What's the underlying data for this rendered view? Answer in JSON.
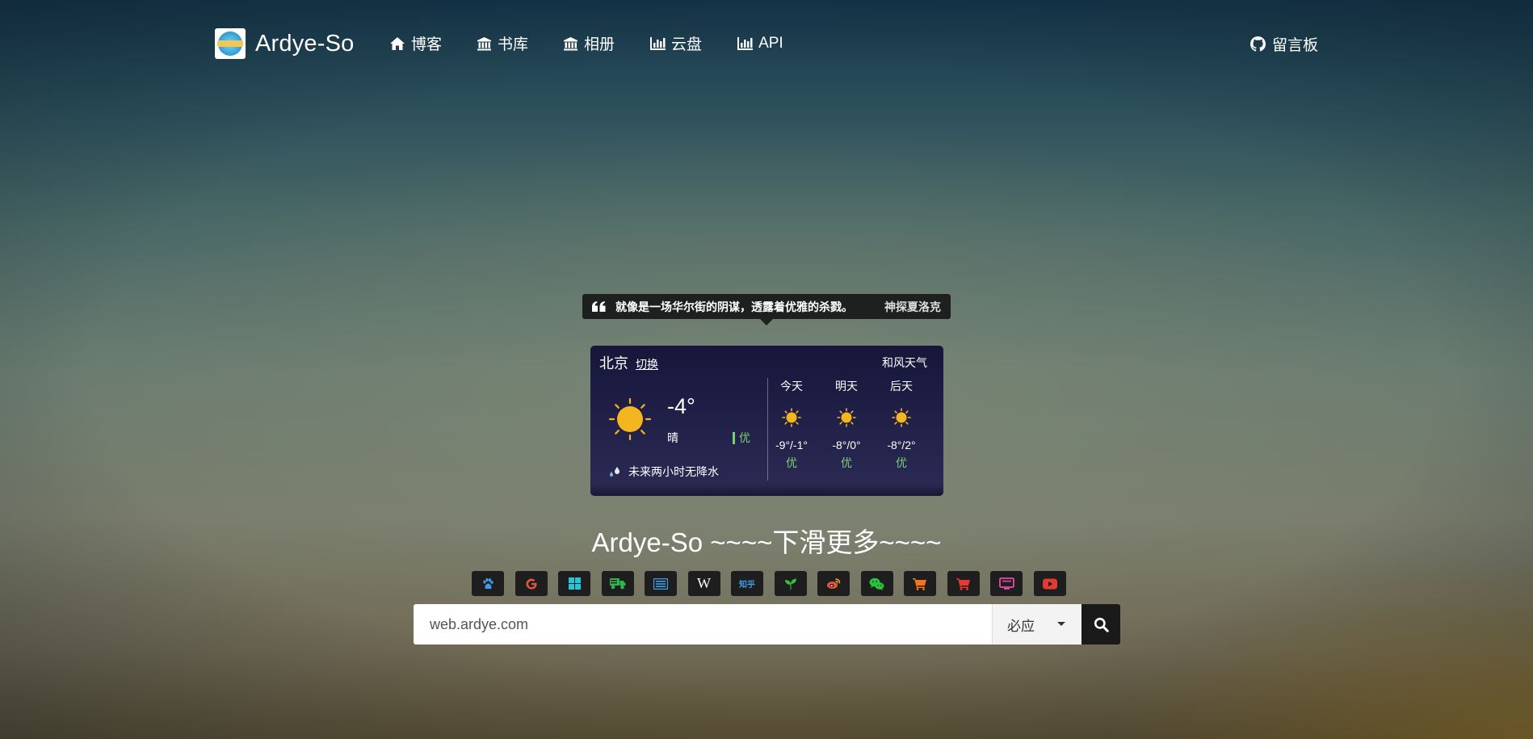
{
  "nav": {
    "brand": "Ardye-So",
    "items": [
      {
        "label": "博客",
        "icon": "home-icon"
      },
      {
        "label": "书库",
        "icon": "bank-icon"
      },
      {
        "label": "相册",
        "icon": "bank-icon"
      },
      {
        "label": "云盘",
        "icon": "bar-chart-icon"
      },
      {
        "label": "API",
        "icon": "bar-chart-icon"
      }
    ],
    "guestbook": {
      "label": "留言板",
      "icon": "github-icon"
    }
  },
  "quote": {
    "text": "就像是一场华尔街的阴谋，透露着优雅的杀戮。",
    "author": "神探夏洛克"
  },
  "weather": {
    "city": "北京",
    "switch": "切换",
    "provider": "和风天气",
    "now": {
      "temp": "-4°",
      "condition": "晴",
      "aqi": "优",
      "icon": "sun-icon"
    },
    "rain_note": "未来两小时无降水",
    "forecast": [
      {
        "day": "今天",
        "range": "-9°/-1°",
        "aqi": "优",
        "icon": "sun-icon"
      },
      {
        "day": "明天",
        "range": "-8°/0°",
        "aqi": "优",
        "icon": "sun-icon"
      },
      {
        "day": "后天",
        "range": "-8°/2°",
        "aqi": "优",
        "icon": "sun-icon"
      }
    ]
  },
  "title": "Ardye-So ~~~~下滑更多~~~~",
  "engines": [
    {
      "name": "baidu",
      "icon": "paw-icon",
      "color": "#3f9ce8"
    },
    {
      "name": "google",
      "icon": "google-icon",
      "color": "#e2553f"
    },
    {
      "name": "bing",
      "icon": "windows-icon",
      "color": "#25c5d8"
    },
    {
      "name": "sogou",
      "icon": "truck-icon",
      "color": "#2bb94d"
    },
    {
      "name": "news",
      "icon": "newspaper-icon",
      "color": "#3f9ce8"
    },
    {
      "name": "wikipedia",
      "icon": "wikipedia-icon",
      "color": "#ffffff",
      "glyph": "W"
    },
    {
      "name": "zhihu",
      "icon": "zhihu-icon",
      "color": "#3f9ce8",
      "glyph": "知乎"
    },
    {
      "name": "douban",
      "icon": "sprout-icon",
      "color": "#37c23c"
    },
    {
      "name": "weibo",
      "icon": "weibo-icon",
      "color": "#e2553f"
    },
    {
      "name": "wechat",
      "icon": "wechat-icon",
      "color": "#2bc23c"
    },
    {
      "name": "taobao",
      "icon": "cart-icon",
      "color": "#f5731a"
    },
    {
      "name": "jd",
      "icon": "cart-icon",
      "color": "#e53935"
    },
    {
      "name": "bilibili",
      "icon": "monitor-icon",
      "color": "#e64ca8"
    },
    {
      "name": "youtube",
      "icon": "youtube-icon",
      "color": "#e53935"
    }
  ],
  "search": {
    "value": "web.ardye.com",
    "engine_selected": "必应"
  }
}
